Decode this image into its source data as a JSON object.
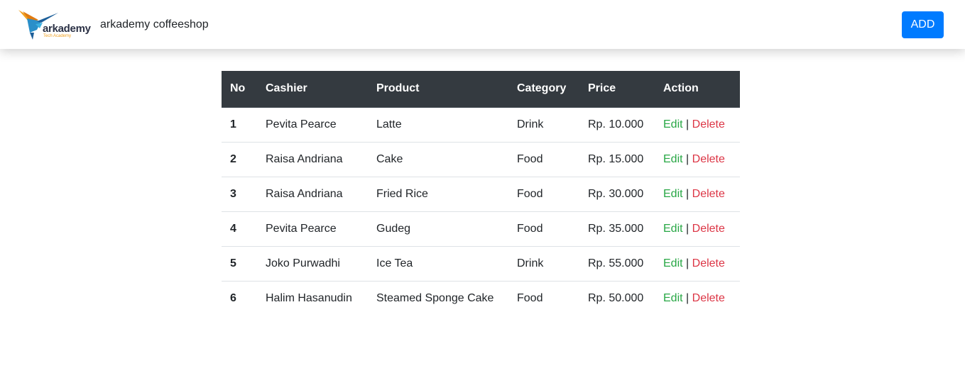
{
  "navbar": {
    "logo_text": "arkademy",
    "logo_subtext": "Tech Academy",
    "brand": "arkademy coffeeshop",
    "add_label": "ADD"
  },
  "table": {
    "headers": [
      "No",
      "Cashier",
      "Product",
      "Category",
      "Price",
      "Action"
    ],
    "edit_label": "Edit",
    "separator": "|",
    "delete_label": "Delete",
    "rows": [
      {
        "no": "1",
        "cashier": "Pevita Pearce",
        "product": "Latte",
        "category": "Drink",
        "price": "Rp. 10.000"
      },
      {
        "no": "2",
        "cashier": "Raisa Andriana",
        "product": "Cake",
        "category": "Food",
        "price": "Rp. 15.000"
      },
      {
        "no": "3",
        "cashier": "Raisa Andriana",
        "product": "Fried Rice",
        "category": "Food",
        "price": "Rp. 30.000"
      },
      {
        "no": "4",
        "cashier": "Pevita Pearce",
        "product": "Gudeg",
        "category": "Food",
        "price": "Rp. 35.000"
      },
      {
        "no": "5",
        "cashier": "Joko Purwadhi",
        "product": "Ice Tea",
        "category": "Drink",
        "price": "Rp. 55.000"
      },
      {
        "no": "6",
        "cashier": "Halim Hasanudin",
        "product": "Steamed Sponge Cake",
        "category": "Food",
        "price": "Rp. 50.000"
      }
    ]
  },
  "colors": {
    "primary": "#007bff",
    "header_dark": "#343a40",
    "edit": "#28a745",
    "delete": "#dc3545"
  }
}
